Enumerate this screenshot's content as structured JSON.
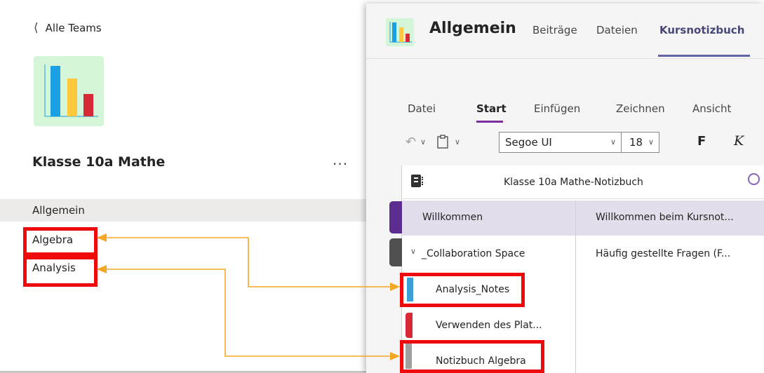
{
  "left_panel": {
    "back_label": "Alle Teams",
    "team_name": "Klasse 10a Mathe",
    "more_label": "...",
    "channels": [
      "Allgemein",
      "Algebra",
      "Analysis"
    ]
  },
  "header": {
    "title": "Allgemein",
    "tabs": [
      "Beiträge",
      "Dateien",
      "Kursnotizbuch"
    ]
  },
  "ribbon": {
    "tabs": [
      "Datei",
      "Start",
      "Einfügen",
      "Zeichnen",
      "Ansicht"
    ],
    "font_name": "Segoe UI",
    "font_size": "18",
    "bold_label": "F",
    "italic_label": "K"
  },
  "notebook": {
    "title": "Klasse 10a Mathe-Notizbuch",
    "sections": [
      "Willkommen",
      "_Collaboration Space",
      "Analysis_Notes",
      "Verwenden des Plat...",
      "Notizbuch Algebra"
    ],
    "pages": [
      "Willkommen beim Kursnot...",
      "Häufig gestellte Fragen (F..."
    ]
  },
  "colors": {
    "accent": "#6264a7",
    "highlight_red": "#ee0a0a",
    "arrow_orange": "#f5a623",
    "logo_bg": "#d5f5d9",
    "bar_blue": "#1ba1e2",
    "bar_yellow": "#ffc83d",
    "bar_red": "#d72936"
  }
}
